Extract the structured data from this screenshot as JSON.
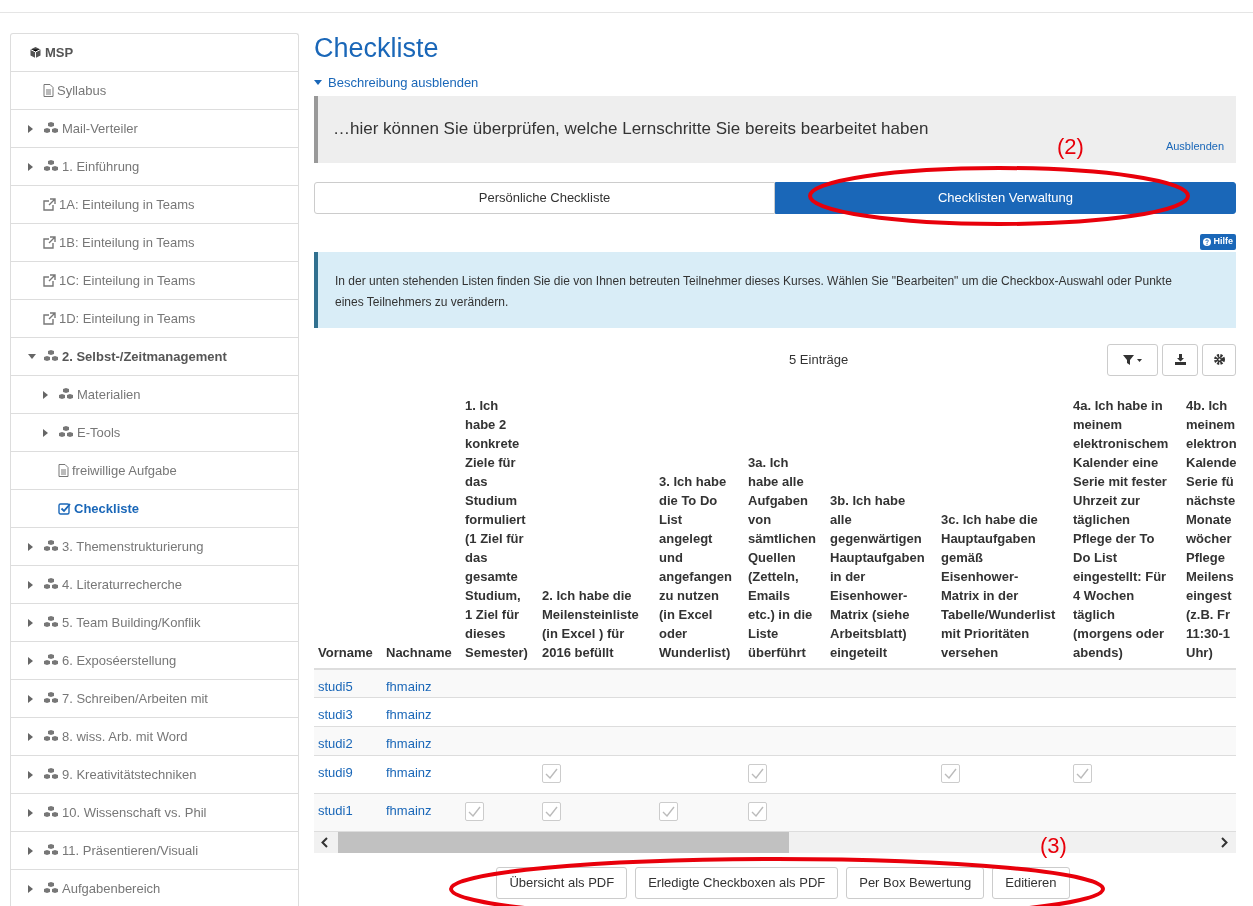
{
  "sidebar": {
    "title": "MSP",
    "items": [
      {
        "label": "Syllabus",
        "kind": "page",
        "selected": false
      },
      {
        "label": "Mail-Verteiler",
        "kind": "folder",
        "expanded": false,
        "selected": false
      },
      {
        "label": "1. Einführung",
        "kind": "folder",
        "expanded": false,
        "selected": false
      },
      {
        "label": "1A: Einteilung in Teams",
        "kind": "link",
        "selected": false
      },
      {
        "label": "1B: Einteilung in Teams",
        "kind": "link",
        "selected": false
      },
      {
        "label": "1C: Einteilung in Teams",
        "kind": "link",
        "selected": false
      },
      {
        "label": "1D: Einteilung in Teams",
        "kind": "link",
        "selected": false
      },
      {
        "label": "2. Selbst-/Zeitmanagement",
        "kind": "folder",
        "expanded": true,
        "selected": false,
        "children": [
          {
            "label": "Materialien",
            "kind": "folder",
            "expanded": false,
            "selected": false
          },
          {
            "label": "E-Tools",
            "kind": "folder",
            "expanded": false,
            "selected": false
          },
          {
            "label": "freiwillige Aufgabe",
            "kind": "page",
            "selected": false
          },
          {
            "label": "Checkliste",
            "kind": "checklist",
            "selected": true
          }
        ]
      },
      {
        "label": "3. Themenstrukturierung",
        "kind": "folder",
        "expanded": false,
        "selected": false
      },
      {
        "label": "4. Literaturrecherche",
        "kind": "folder",
        "expanded": false,
        "selected": false
      },
      {
        "label": "5. Team Building/Konflik",
        "kind": "folder",
        "expanded": false,
        "selected": false
      },
      {
        "label": "6. Exposéerstellung",
        "kind": "folder",
        "expanded": false,
        "selected": false
      },
      {
        "label": "7. Schreiben/Arbeiten mit",
        "kind": "folder",
        "expanded": false,
        "selected": false
      },
      {
        "label": "8. wiss. Arb. mit Word",
        "kind": "folder",
        "expanded": false,
        "selected": false
      },
      {
        "label": "9. Kreativitätstechniken",
        "kind": "folder",
        "expanded": false,
        "selected": false
      },
      {
        "label": "10. Wissenschaft vs. Phil",
        "kind": "folder",
        "expanded": false,
        "selected": false
      },
      {
        "label": "11. Präsentieren/Visuali",
        "kind": "folder",
        "expanded": false,
        "selected": false
      },
      {
        "label": "Aufgabenbereich",
        "kind": "folder",
        "expanded": false,
        "selected": false
      }
    ]
  },
  "page_title": "Checkliste",
  "description_toggle": "Beschreibung ausblenden",
  "description": {
    "text": "…hier können Sie überprüfen, welche Lernschritte Sie bereits bearbeitet haben",
    "hide_link": "Ausblenden"
  },
  "tabs": [
    {
      "label": "Persönliche Checkliste",
      "selected": false
    },
    {
      "label": "Checklisten Verwaltung",
      "selected": true
    }
  ],
  "help_button": "Hilfe",
  "info": "In der unten stehenden Listen finden Sie die von Ihnen betreuten Teilnehmer dieses Kurses. Wählen Sie \"Bearbeiten\" um die Checkbox-Auswahl oder Punkte eines Teilnehmers zu verändern.",
  "table": {
    "count": "5 Einträge",
    "columns": [
      "Vorname",
      "Nachname",
      "1. Ich\nhabe 2\nkonkrete\nZiele für\ndas\nStudium\nformuliert\n(1 Ziel für\ndas\ngesamte\nStudium,\n1 Ziel für\ndieses\nSemester)",
      "2. Ich habe die\nMeilensteinliste\n(in Excel ) für\n2016 befüllt",
      "3. Ich habe\ndie To Do\nList\nangelegt\nund\nangefangen\nzu nutzen\n(in Excel\noder\nWunderlist)",
      "3a. Ich\nhabe alle\nAufgaben\nvon\nsämtlichen\nQuellen\n(Zetteln,\nEmails\netc.) in die\nListe\nüberführt",
      "3b. Ich habe\nalle\ngegenwärtigen\nHauptaufgaben\nin der\nEisenhower-\nMatrix (siehe\nArbeitsblatt)\neingeteilt",
      "3c. Ich habe die\nHauptaufgaben\ngemäß\nEisenhower-\nMatrix in der\nTabelle/Wunderlist\nmit Prioritäten\nversehen",
      "4a. Ich habe in\nmeinem\nelektronischem\nKalender eine\nSerie mit fester\nUhrzeit zur\ntäglichen\nPflege der To\nDo List\neingestellt: Für\n4 Wochen\ntäglich\n(morgens oder\nabends)",
      "4b. Ich\nmeinem\nelektron\nKalende\nSerie fü\nnächste\nMonate\nwöcher\nPflege\nMeilens\neingest\n(z.B. Fr\n11:30-1\nUhr)"
    ],
    "rows": [
      {
        "first": "studi5",
        "last": "fhmainz",
        "checks": [
          false,
          false,
          false,
          false,
          false,
          false,
          false,
          false
        ]
      },
      {
        "first": "studi3",
        "last": "fhmainz",
        "checks": [
          false,
          false,
          false,
          false,
          false,
          false,
          false,
          false
        ]
      },
      {
        "first": "studi2",
        "last": "fhmainz",
        "checks": [
          false,
          false,
          false,
          false,
          false,
          false,
          false,
          false
        ]
      },
      {
        "first": "studi9",
        "last": "fhmainz",
        "checks": [
          false,
          true,
          false,
          true,
          false,
          true,
          true,
          false
        ]
      },
      {
        "first": "studi1",
        "last": "fhmainz",
        "checks": [
          true,
          true,
          true,
          true,
          false,
          false,
          false,
          false
        ]
      }
    ]
  },
  "buttons": [
    "Übersicht als PDF",
    "Erledigte Checkboxen als PDF",
    "Per Box Bewertung",
    "Editieren"
  ],
  "annotations": [
    {
      "label": "(2)"
    },
    {
      "label": "(3)"
    }
  ]
}
